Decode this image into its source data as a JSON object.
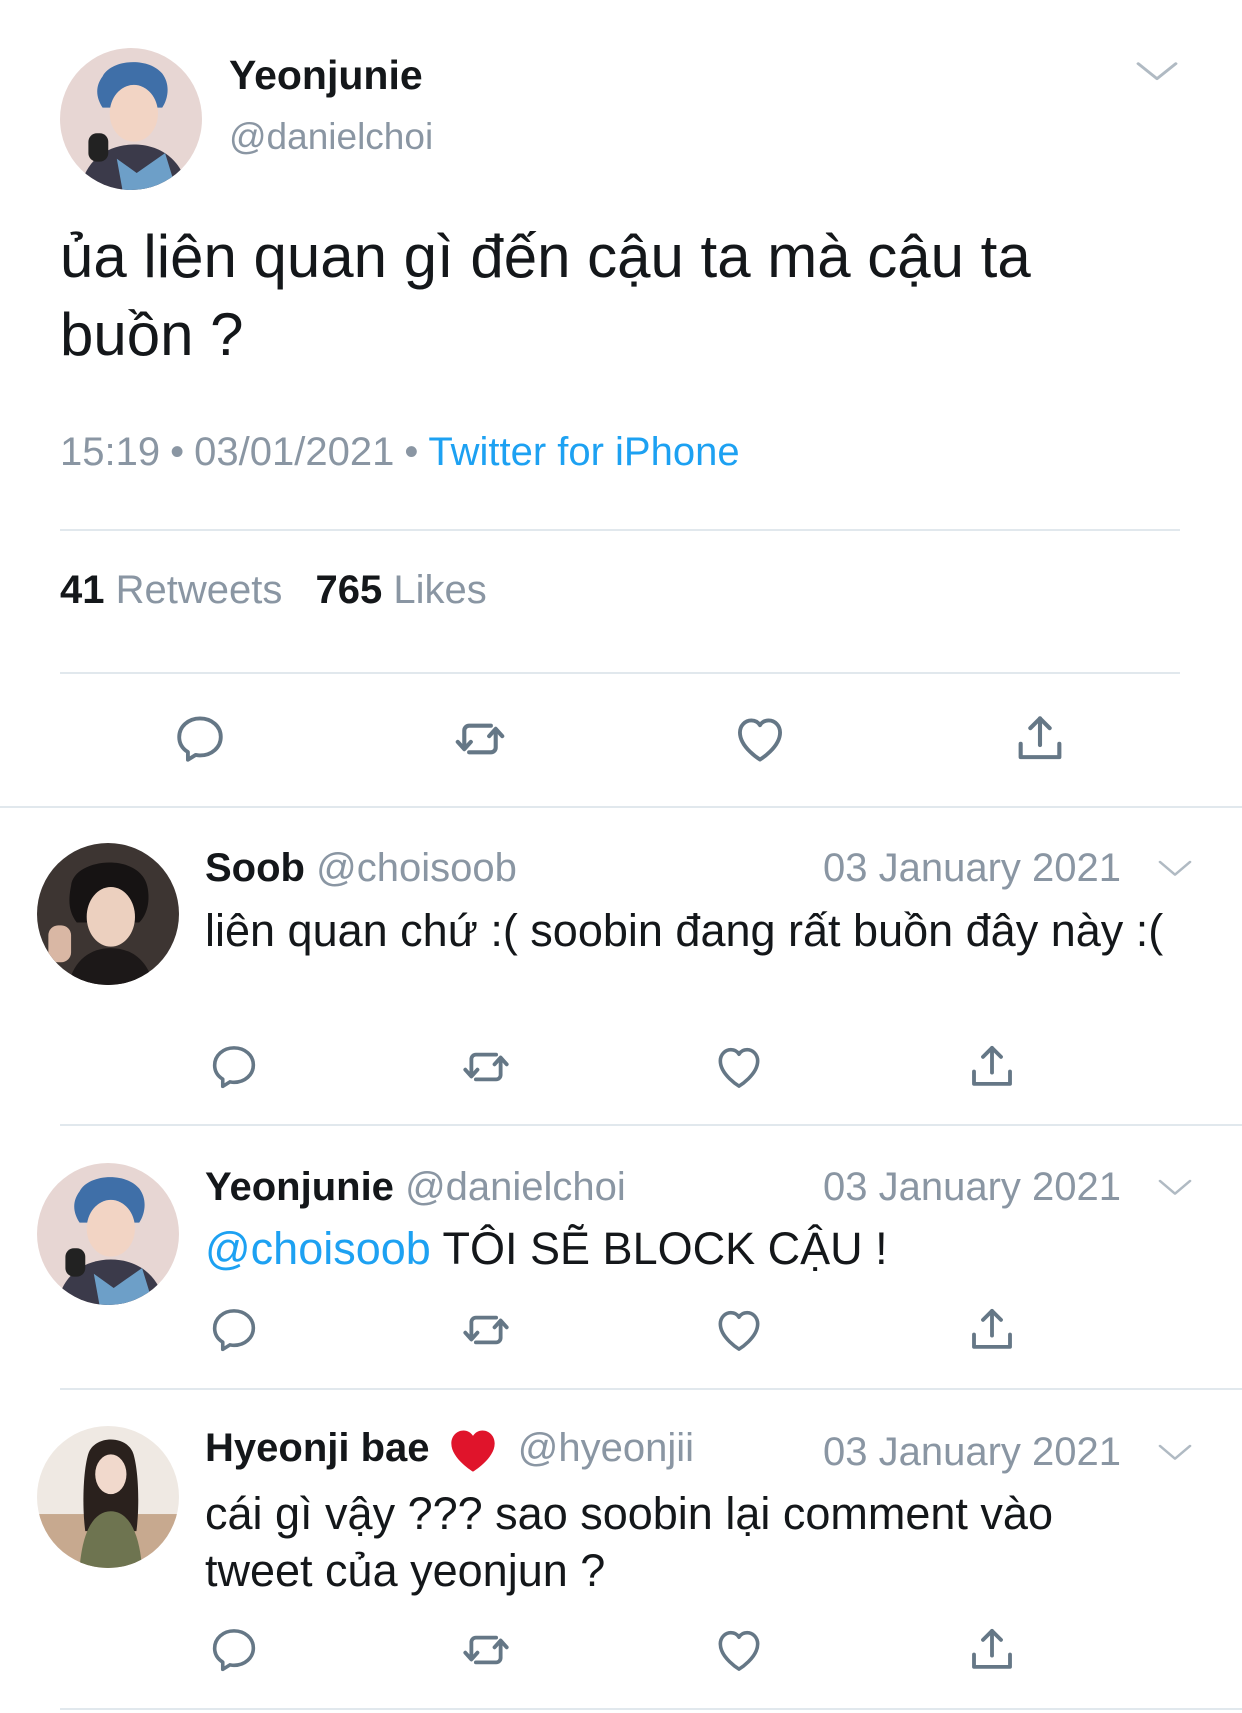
{
  "main_tweet": {
    "display_name": "Yeonjunie",
    "handle": "@danielchoi",
    "text": "ủa liên quan gì đến cậu ta mà cậu ta buồn ?",
    "time": "15:19",
    "date": "03/01/2021",
    "source": "Twitter for iPhone",
    "retweets_count": "41",
    "retweets_label": "Retweets",
    "likes_count": "765",
    "likes_label": "Likes"
  },
  "replies": [
    {
      "display_name": "Soob",
      "handle": "@choisoob",
      "date": "03 January 2021",
      "text": "liên quan chứ :( soobin đang rất buồn đây này :("
    },
    {
      "display_name": "Yeonjunie",
      "handle": "@danielchoi",
      "date": "03 January 2021",
      "mention": "@choisoob",
      "text": "TÔI SẼ BLOCK CẬU !"
    },
    {
      "display_name": "Hyeonji bae",
      "display_emoji": "heart-emoji",
      "handle": "@hyeonjii",
      "date": "03 January 2021",
      "text": "cái gì vậy ??? sao soobin lại comment vào tweet của yeonjun ?"
    }
  ],
  "icons": [
    "reply-icon",
    "retweet-icon",
    "like-icon",
    "share-icon",
    "chevron-down-icon"
  ],
  "colors": {
    "link": "#1da1f2",
    "muted": "#8a96a3",
    "text": "#14171a",
    "divider": "#e1e8ed",
    "heart": "#e0142b"
  }
}
